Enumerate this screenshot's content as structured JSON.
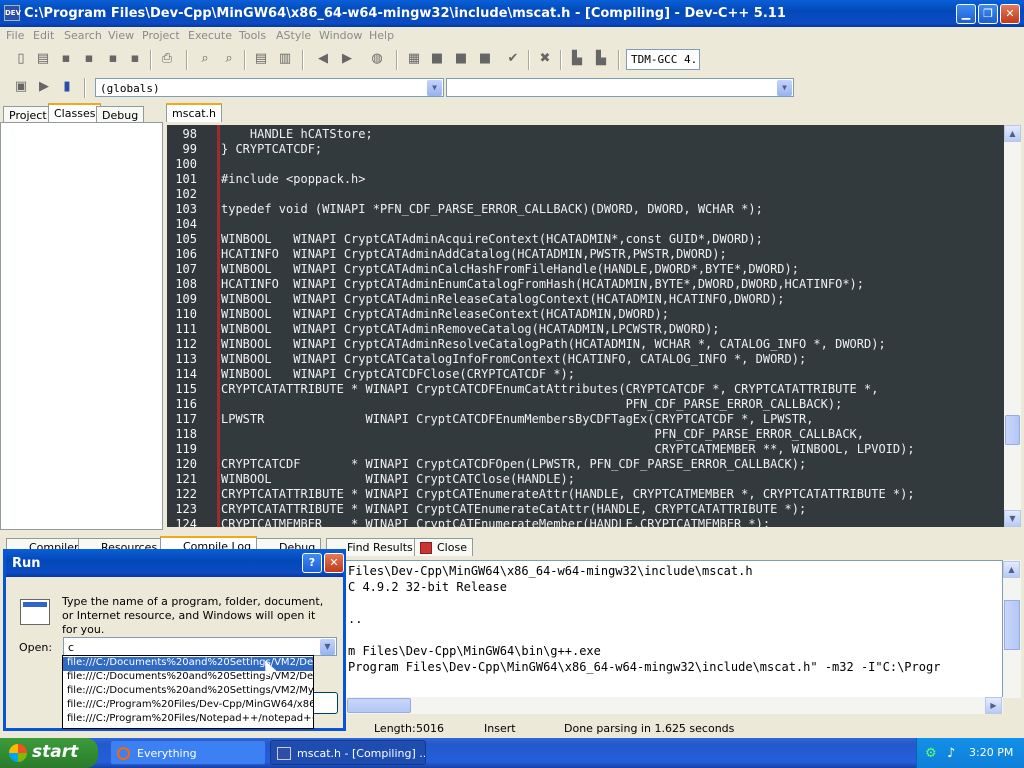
{
  "window": {
    "title": "C:\\Program Files\\Dev-Cpp\\MinGW64\\x86_64-w64-mingw32\\include\\mscat.h - [Compiling] - Dev-C++ 5.11",
    "icon_text": "DEV"
  },
  "menu": [
    "File",
    "Edit",
    "Search",
    "View",
    "Project",
    "Execute",
    "Tools",
    "AStyle",
    "Window",
    "Help"
  ],
  "toolbar": {
    "compiler_combo": "TDM-GCC 4.",
    "globals_combo": "(globals)",
    "function_combo": ""
  },
  "left_tabs": [
    "Project",
    "Classes",
    "Debug"
  ],
  "editor_tab": "mscat.h",
  "code_lines": [
    {
      "n": "98",
      "t": "    HANDLE hCATStore;"
    },
    {
      "n": "99",
      "t": "} CRYPTCATCDF;"
    },
    {
      "n": "100",
      "t": ""
    },
    {
      "n": "101",
      "t": "#include <poppack.h>"
    },
    {
      "n": "102",
      "t": ""
    },
    {
      "n": "103",
      "t": "typedef void (WINAPI *PFN_CDF_PARSE_ERROR_CALLBACK)(DWORD, DWORD, WCHAR *);"
    },
    {
      "n": "104",
      "t": ""
    },
    {
      "n": "105",
      "t": "WINBOOL   WINAPI CryptCATAdminAcquireContext(HCATADMIN*,const GUID*,DWORD);"
    },
    {
      "n": "106",
      "t": "HCATINFO  WINAPI CryptCATAdminAddCatalog(HCATADMIN,PWSTR,PWSTR,DWORD);"
    },
    {
      "n": "107",
      "t": "WINBOOL   WINAPI CryptCATAdminCalcHashFromFileHandle(HANDLE,DWORD*,BYTE*,DWORD);"
    },
    {
      "n": "108",
      "t": "HCATINFO  WINAPI CryptCATAdminEnumCatalogFromHash(HCATADMIN,BYTE*,DWORD,DWORD,HCATINFO*);"
    },
    {
      "n": "109",
      "t": "WINBOOL   WINAPI CryptCATAdminReleaseCatalogContext(HCATADMIN,HCATINFO,DWORD);"
    },
    {
      "n": "110",
      "t": "WINBOOL   WINAPI CryptCATAdminReleaseContext(HCATADMIN,DWORD);"
    },
    {
      "n": "111",
      "t": "WINBOOL   WINAPI CryptCATAdminRemoveCatalog(HCATADMIN,LPCWSTR,DWORD);"
    },
    {
      "n": "112",
      "t": "WINBOOL   WINAPI CryptCATAdminResolveCatalogPath(HCATADMIN, WCHAR *, CATALOG_INFO *, DWORD);"
    },
    {
      "n": "113",
      "t": "WINBOOL   WINAPI CryptCATCatalogInfoFromContext(HCATINFO, CATALOG_INFO *, DWORD);"
    },
    {
      "n": "114",
      "t": "WINBOOL   WINAPI CryptCATCDFClose(CRYPTCATCDF *);"
    },
    {
      "n": "115",
      "t": "CRYPTCATATTRIBUTE * WINAPI CryptCATCDFEnumCatAttributes(CRYPTCATCDF *, CRYPTCATATTRIBUTE *,"
    },
    {
      "n": "116",
      "t": "                                                        PFN_CDF_PARSE_ERROR_CALLBACK);"
    },
    {
      "n": "117",
      "t": "LPWSTR              WINAPI CryptCATCDFEnumMembersByCDFTagEx(CRYPTCATCDF *, LPWSTR,"
    },
    {
      "n": "118",
      "t": "                                                            PFN_CDF_PARSE_ERROR_CALLBACK,"
    },
    {
      "n": "119",
      "t": "                                                            CRYPTCATMEMBER **, WINBOOL, LPVOID);"
    },
    {
      "n": "120",
      "t": "CRYPTCATCDF       * WINAPI CryptCATCDFOpen(LPWSTR, PFN_CDF_PARSE_ERROR_CALLBACK);"
    },
    {
      "n": "121",
      "t": "WINBOOL             WINAPI CryptCATClose(HANDLE);"
    },
    {
      "n": "122",
      "t": "CRYPTCATATTRIBUTE * WINAPI CryptCATEnumerateAttr(HANDLE, CRYPTCATMEMBER *, CRYPTCATATTRIBUTE *);"
    },
    {
      "n": "123",
      "t": "CRYPTCATATTRIBUTE * WINAPI CryptCATEnumerateCatAttr(HANDLE, CRYPTCATATTRIBUTE *);"
    },
    {
      "n": "124",
      "t": "CRYPTCATMEMBER    * WINAPI CryptCATEnumerateMember(HANDLE,CRYPTCATMEMBER *);"
    }
  ],
  "bottom_tabs": [
    "Compiler",
    "Resources",
    "Compile Log",
    "Debug",
    "Find Results",
    "Close"
  ],
  "log_lines": [
    "Files\\Dev-Cpp\\MinGW64\\x86_64-w64-mingw32\\include\\mscat.h",
    "C 4.9.2 32-bit Release",
    "",
    "..",
    "",
    "m Files\\Dev-Cpp\\MinGW64\\bin\\g++.exe",
    "Program Files\\Dev-Cpp\\MinGW64\\x86_64-w64-mingw32\\include\\mscat.h\" -m32 -I\"C:\\Progr"
  ],
  "status": {
    "length_label": "Length:",
    "length_value": "5016",
    "mode": "Insert",
    "message": "Done parsing in 1.625 seconds"
  },
  "run_dialog": {
    "title": "Run",
    "help": "?",
    "description": "Type the name of a program, folder, document, or Internet resource, and Windows will open it for you.",
    "open_label": "Open:",
    "open_value": "c",
    "suggestions": [
      "file:///C:/Documents%20and%20Settings/VM2/Des",
      "file:///C:/Documents%20and%20Settings/VM2/Des",
      "file:///C:/Documents%20and%20Settings/VM2/My",
      "file:///C:/Program%20Files/Dev-Cpp/MinGW64/x86",
      "file:///C:/Program%20Files/Notepad++/notepad++"
    ]
  },
  "taskbar": {
    "start": "start",
    "tasks": [
      "Everything",
      "mscat.h - [Compiling] ..."
    ],
    "clock": "3:20 PM"
  }
}
